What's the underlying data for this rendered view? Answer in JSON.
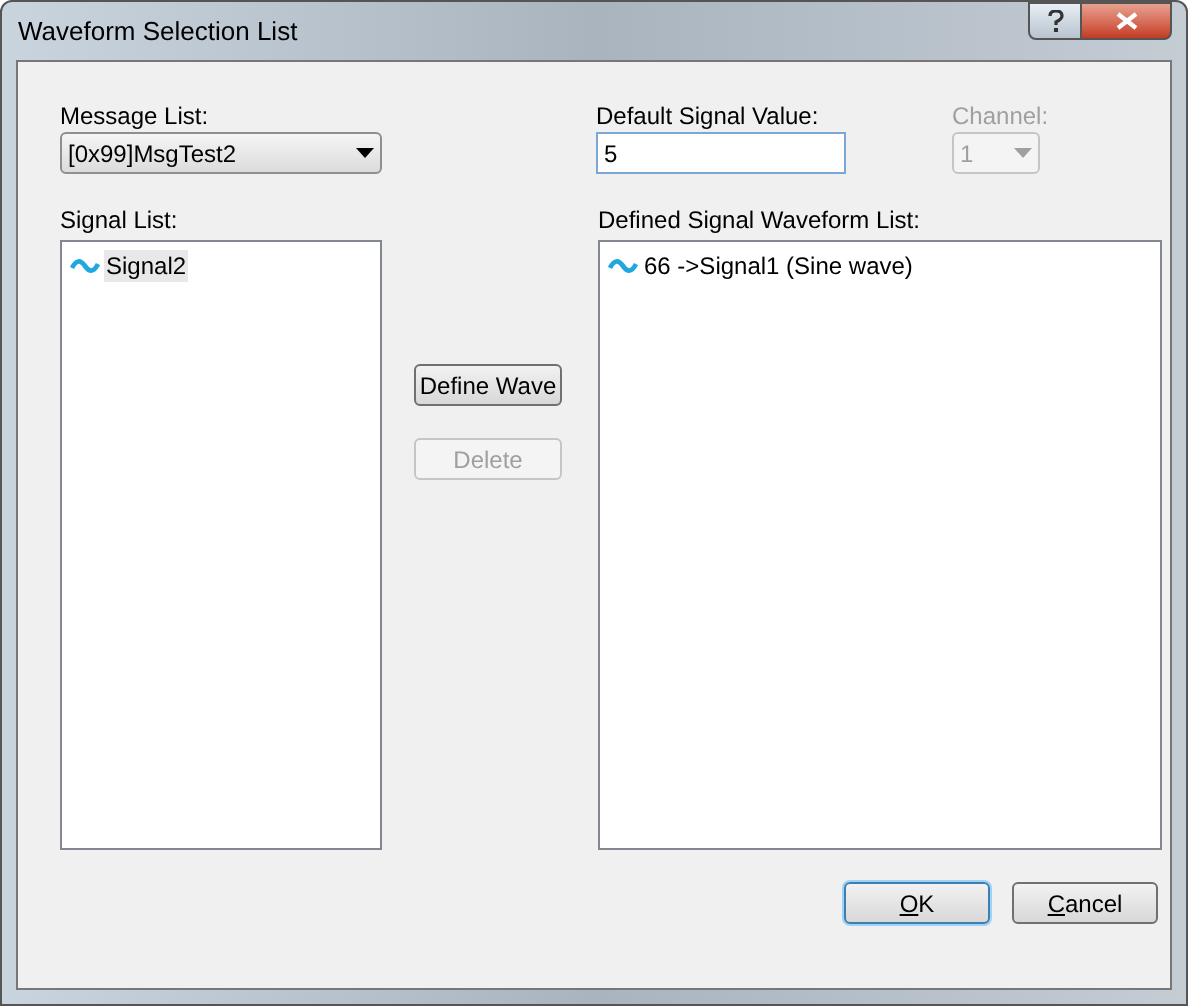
{
  "window": {
    "title": "Waveform Selection List"
  },
  "message_list": {
    "label": "Message List:",
    "value": "[0x99]MsgTest2"
  },
  "default_signal_value": {
    "label": "Default Signal Value:",
    "value": "5"
  },
  "channel": {
    "label": "Channel:",
    "value": "1",
    "disabled": true
  },
  "signal_list": {
    "label": "Signal List:",
    "items": [
      {
        "text": "Signal2",
        "selected": true
      }
    ]
  },
  "defined_list": {
    "label": "Defined Signal Waveform List:",
    "items": [
      {
        "text": "66 ->Signal1 (Sine wave)",
        "selected": false
      }
    ]
  },
  "middle_buttons": [
    {
      "label": "Define Wave",
      "disabled": false
    },
    {
      "label": "Delete",
      "disabled": true
    }
  ],
  "buttons": [
    {
      "label": "OK",
      "first_letter_underlined": true,
      "default": true
    },
    {
      "label": "Cancel",
      "first_letter_underlined": true,
      "default": false
    }
  ]
}
